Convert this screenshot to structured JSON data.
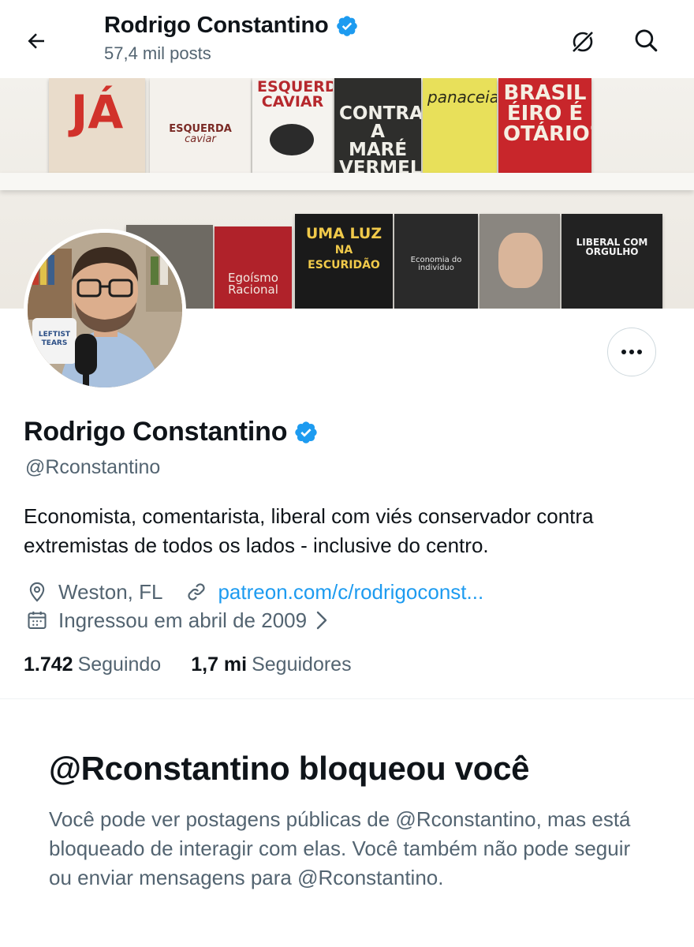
{
  "header": {
    "title": "Rodrigo Constantino",
    "post_count": "57,4 mil posts"
  },
  "banner": {
    "books": [
      {
        "title": "PRIVATIZE JÁ",
        "color": "#e9dccb"
      },
      {
        "title": "ESQUERDA CAVIAR",
        "color": "#f4f1ec"
      },
      {
        "title": "ESQUERDA CAVIAR",
        "color": "#f5f3ef"
      },
      {
        "title": "CONTRA A MARÉ VERMELHA",
        "color": "#2e2e2c"
      },
      {
        "title": "panaceia",
        "color": "#e8e05a"
      },
      {
        "title": "BRASIL É O PAÍS DO FUTURO E OTÁRIO?",
        "color": "#c8262b"
      },
      {
        "title": "Egoísmo Racional",
        "color": "#b0222a"
      },
      {
        "title": "UMA LUZ NA ESCURIDÃO",
        "color": "#1a1a1a"
      },
      {
        "title": "Economia do indivíduo",
        "color": "#2a2a2a"
      },
      {
        "title": "LIBERAL COM ORGULHO",
        "color": "#222222"
      }
    ]
  },
  "profile": {
    "name": "Rodrigo Constantino",
    "handle": "@Rconstantino",
    "bio": "Economista, comentarista, liberal com viés conservador contra extremistas de todos os lados - inclusive do centro.",
    "location": "Weston, FL",
    "website": "patreon.com/c/rodrigoconst...",
    "joined": "Ingressou em abril de 2009",
    "following_count": "1.742",
    "following_label": "Seguindo",
    "followers_count": "1,7 mi",
    "followers_label": "Seguidores",
    "mug_text": "LEFTIST TEARS"
  },
  "blocked": {
    "title": "@Rconstantino bloqueou você",
    "message": "Você pode ver postagens públicas de @Rconstantino, mas está bloqueado de interagir com elas. Você também não pode seguir ou enviar mensagens para @Rconstantino."
  },
  "colors": {
    "accent": "#1d9bf0",
    "text_primary": "#0f1419",
    "text_secondary": "#536471",
    "verified": "#1d9bf0"
  }
}
